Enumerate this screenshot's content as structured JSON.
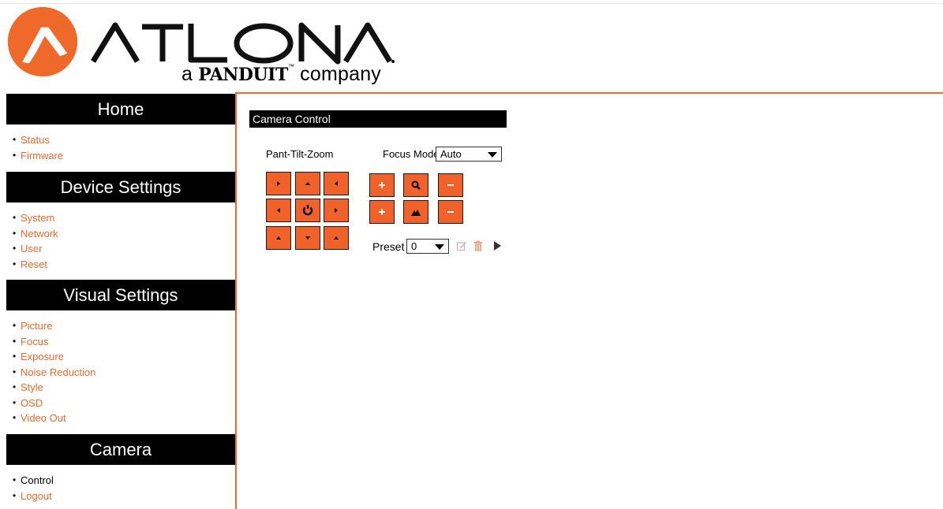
{
  "brand": {
    "wordmark": "ATLONA",
    "tagline_prefix": "a",
    "tagline_brand": "PANDUIT",
    "tagline_suffix": "company",
    "accent_color": "#ef6a2a"
  },
  "sidebar": {
    "sections": [
      {
        "title": "Home",
        "items": [
          {
            "label": "Status"
          },
          {
            "label": "Firmware"
          }
        ]
      },
      {
        "title": "Device Settings",
        "items": [
          {
            "label": "System"
          },
          {
            "label": "Network"
          },
          {
            "label": "User"
          },
          {
            "label": "Reset"
          }
        ]
      },
      {
        "title": "Visual Settings",
        "items": [
          {
            "label": "Picture"
          },
          {
            "label": "Focus"
          },
          {
            "label": "Exposure"
          },
          {
            "label": "Noise Reduction"
          },
          {
            "label": "Style"
          },
          {
            "label": "OSD"
          },
          {
            "label": "Video Out"
          }
        ]
      },
      {
        "title": "Camera",
        "items": [
          {
            "label": "Control",
            "current": true
          },
          {
            "label": "Logout"
          }
        ]
      }
    ]
  },
  "main": {
    "panel_title": "Camera Control",
    "ptz_label": "Pant-Tilt-Zoom",
    "focus_mode": {
      "label": "Focus Mode",
      "value": "Auto"
    },
    "preset": {
      "label": "Preset",
      "value": "0"
    },
    "ptz_buttons": [
      {
        "name": "pan-up-left-button",
        "icon": "arrow-up-left"
      },
      {
        "name": "tilt-up-button",
        "icon": "arrow-up"
      },
      {
        "name": "pan-up-right-button",
        "icon": "arrow-up-right"
      },
      {
        "name": "pan-left-button",
        "icon": "arrow-left"
      },
      {
        "name": "home-reset-button",
        "icon": "rotate-icon"
      },
      {
        "name": "pan-right-button",
        "icon": "arrow-right"
      },
      {
        "name": "pan-down-left-button",
        "icon": "arrow-down-left"
      },
      {
        "name": "tilt-down-button",
        "icon": "arrow-down"
      },
      {
        "name": "pan-down-right-button",
        "icon": "arrow-down-right"
      }
    ],
    "zoom_buttons": [
      {
        "name": "zoom-in-button",
        "icon": "plus-icon"
      },
      {
        "name": "zoom-icon-button",
        "icon": "magnifier-icon"
      },
      {
        "name": "zoom-out-button",
        "icon": "minus-icon"
      }
    ],
    "focus_buttons": [
      {
        "name": "focus-near-button",
        "icon": "plus-icon"
      },
      {
        "name": "focus-icon-button",
        "icon": "mountain-icon"
      },
      {
        "name": "focus-far-button",
        "icon": "minus-icon"
      }
    ],
    "preset_actions": [
      {
        "name": "preset-edit-button",
        "icon": "edit-icon"
      },
      {
        "name": "preset-delete-button",
        "icon": "trash-icon"
      },
      {
        "name": "preset-play-button",
        "icon": "play-icon"
      }
    ]
  }
}
